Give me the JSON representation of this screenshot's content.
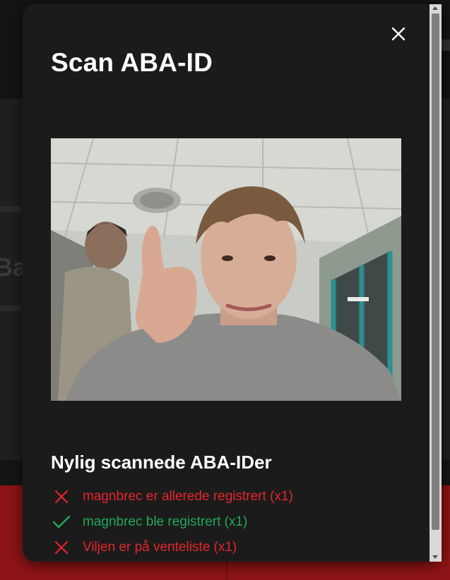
{
  "modal": {
    "title": "Scan ABA-ID",
    "close_icon": "close-icon",
    "camera_feed": "camera-feed"
  },
  "recent": {
    "title": "Nylig scannede ABA-IDer",
    "items": [
      {
        "status": "error",
        "icon": "x-icon",
        "text": "magnbrec er allerede registrert (x1)"
      },
      {
        "status": "success",
        "icon": "check-icon",
        "text": "magnbrec ble registrert (x1)"
      },
      {
        "status": "error",
        "icon": "x-icon",
        "text": "Viljen er på venteliste (x1)"
      }
    ]
  },
  "colors": {
    "error": "#e6262b",
    "success": "#22a85a",
    "modal_bg": "#1b1b1b",
    "footer_bg": "#8d1416"
  }
}
